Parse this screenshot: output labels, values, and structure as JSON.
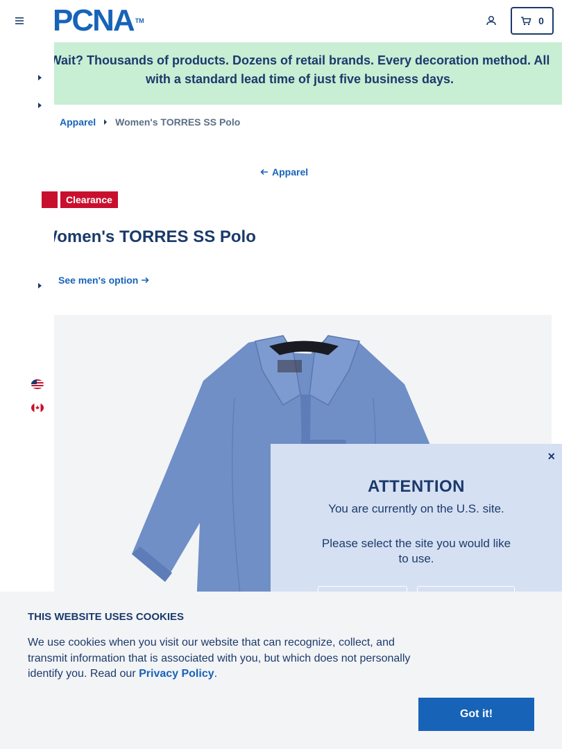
{
  "header": {
    "logo_text": "PCNA",
    "logo_tm": "TM",
    "cart_count": "0"
  },
  "promo": {
    "text": "Wait? Thousands of products. Dozens of retail brands. Every decoration method. All with a standard lead time of just five business days."
  },
  "breadcrumb": {
    "parent": "Apparel",
    "current": "Women's TORRES SS Polo"
  },
  "back_link": "Apparel",
  "badge": "Clearance",
  "product": {
    "title": "Women's TORRES SS Polo",
    "alt_option": "See men's option"
  },
  "modal": {
    "close": "×",
    "title": "ATTENTION",
    "line1": "You are currently on the U.S. site.",
    "line2": "Please select the site you would like to use."
  },
  "cookie": {
    "title": "THIS WEBSITE USES COOKIES",
    "text": "We use cookies when you visit our website that can recognize, collect, and transmit information that is associated with you, but which does not personally identify you. Read our ",
    "link": "Privacy Policy",
    "end": ".",
    "button": "Got it!"
  },
  "colors": {
    "navy": "#1b3a6b",
    "blue": "#1763b8",
    "promo_bg": "#c8eed4",
    "clearance_red": "#c8102e",
    "modal_bg": "#d6e0f3"
  }
}
